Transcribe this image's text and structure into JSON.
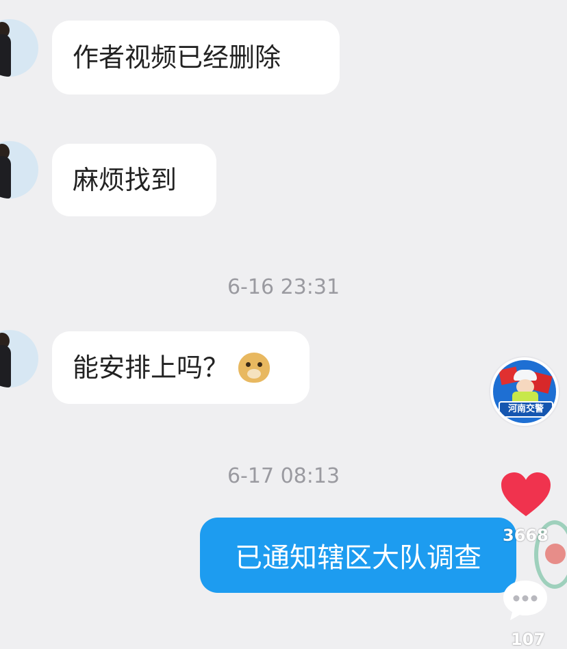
{
  "messages": [
    {
      "text": "作者视频已经删除"
    },
    {
      "text": "麻烦找到"
    },
    {
      "text": "能安排上吗？"
    }
  ],
  "timestamps": [
    "6-16 23:31",
    "6-17 08:13"
  ],
  "reply": {
    "text": "已通知辖区大队调查"
  },
  "side": {
    "avatar_label": "河南交警",
    "like_count": "3668",
    "comment_count": "107"
  },
  "colors": {
    "background": "#efeff1",
    "reply_bubble": "#1d9cf0",
    "like_heart": "#f0334e"
  }
}
